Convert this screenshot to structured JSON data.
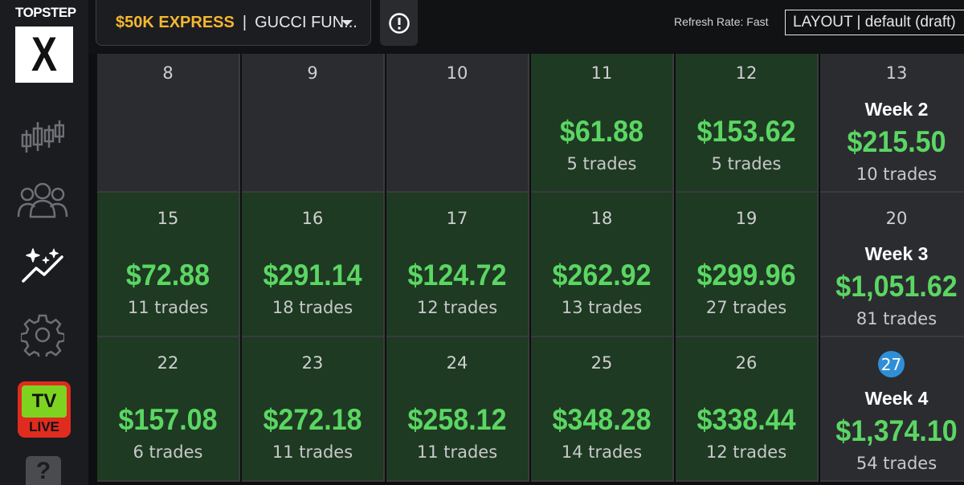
{
  "brand": {
    "wordmark": "TOPSTEP",
    "mark": "X"
  },
  "sidebar": {
    "items": [
      {
        "name": "chart"
      },
      {
        "name": "community"
      },
      {
        "name": "analytics"
      },
      {
        "name": "settings"
      }
    ],
    "tv": {
      "label": "TV",
      "badge": "LIVE"
    },
    "help": "?"
  },
  "account": {
    "name": "$50K EXPRESS",
    "separator": "|",
    "sub": "GUCCI FUN..."
  },
  "refresh_rate": "Refresh Rate: Fast",
  "layout": "LAYOUT | default (draft)",
  "calendar": {
    "weeks": [
      {
        "days": [
          {
            "day": "8",
            "pnl": "",
            "trades": ""
          },
          {
            "day": "9",
            "pnl": "",
            "trades": ""
          },
          {
            "day": "10",
            "pnl": "",
            "trades": ""
          },
          {
            "day": "11",
            "pnl": "$61.88",
            "trades": "5 trades"
          },
          {
            "day": "12",
            "pnl": "$153.62",
            "trades": "5 trades"
          }
        ],
        "summary": {
          "day": "13",
          "label": "Week 2",
          "pnl": "$215.50",
          "trades": "10 trades"
        }
      },
      {
        "days": [
          {
            "day": "15",
            "pnl": "$72.88",
            "trades": "11 trades"
          },
          {
            "day": "16",
            "pnl": "$291.14",
            "trades": "18 trades"
          },
          {
            "day": "17",
            "pnl": "$124.72",
            "trades": "12 trades"
          },
          {
            "day": "18",
            "pnl": "$262.92",
            "trades": "13 trades"
          },
          {
            "day": "19",
            "pnl": "$299.96",
            "trades": "27 trades"
          }
        ],
        "summary": {
          "day": "20",
          "label": "Week 3",
          "pnl": "$1,051.62",
          "trades": "81 trades"
        }
      },
      {
        "days": [
          {
            "day": "22",
            "pnl": "$157.08",
            "trades": "6 trades"
          },
          {
            "day": "23",
            "pnl": "$272.18",
            "trades": "11 trades"
          },
          {
            "day": "24",
            "pnl": "$258.12",
            "trades": "11 trades"
          },
          {
            "day": "25",
            "pnl": "$348.28",
            "trades": "14 trades"
          },
          {
            "day": "26",
            "pnl": "$338.44",
            "trades": "12 trades"
          }
        ],
        "summary": {
          "day": "27",
          "label": "Week 4",
          "pnl": "$1,374.10",
          "trades": "54 trades",
          "today": true
        }
      }
    ]
  },
  "colors": {
    "accent": "#f5b731",
    "profit": "#5bd663",
    "profit_cell": "#1e3a22",
    "empty_cell": "#2b2c30",
    "today": "#2f8fd6"
  }
}
